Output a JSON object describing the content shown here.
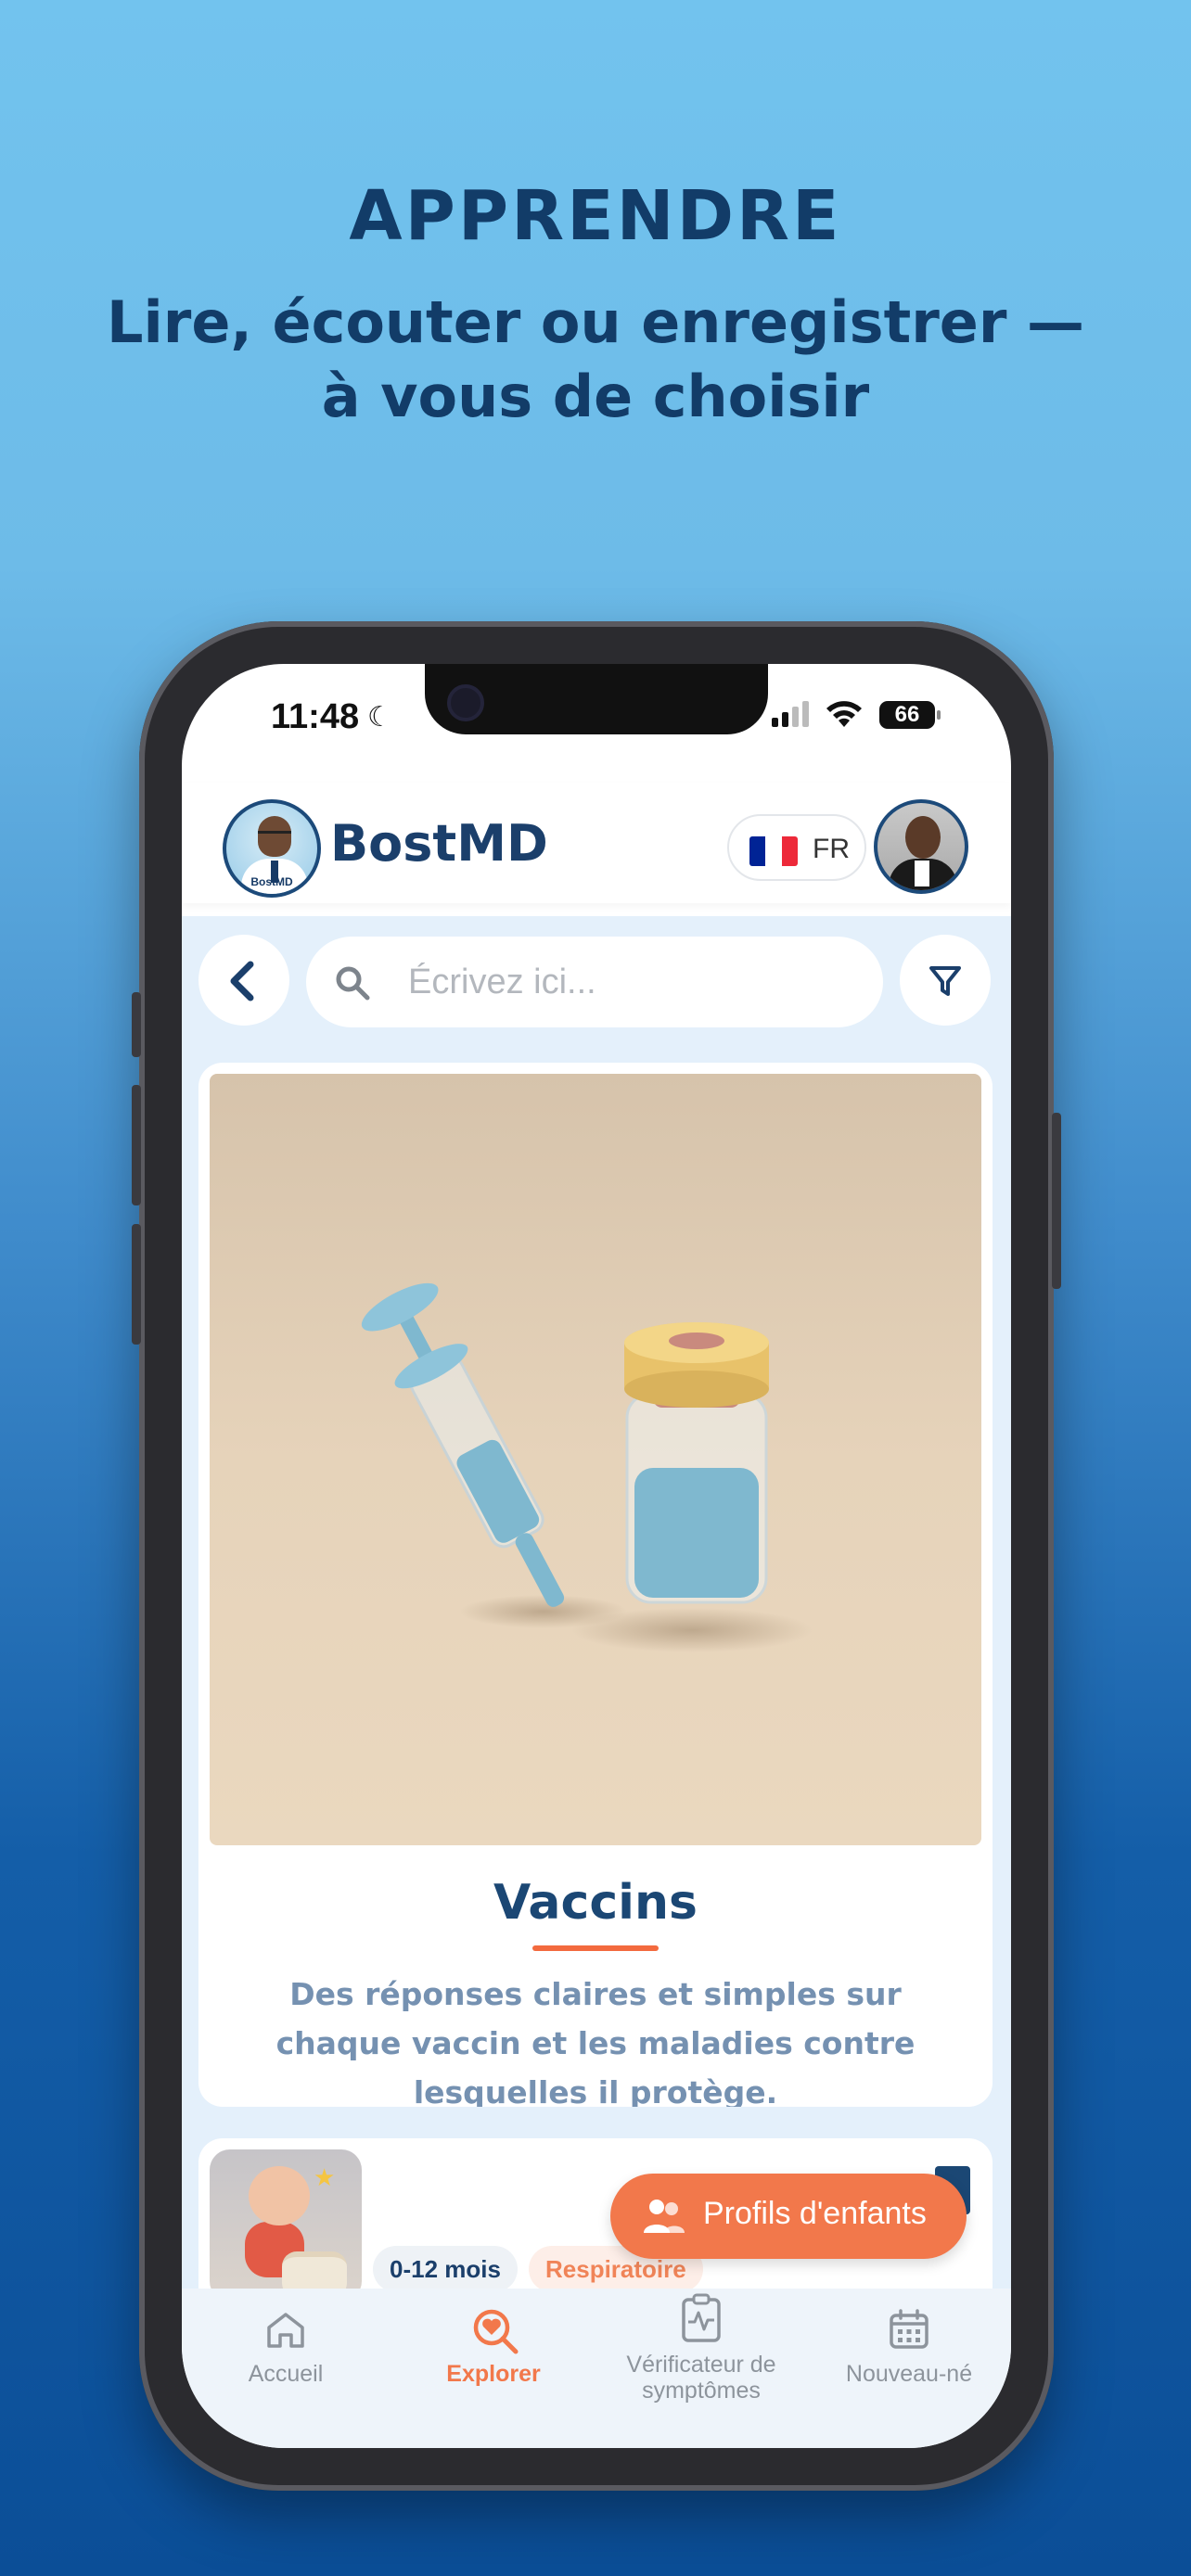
{
  "promo": {
    "headline": "APPRENDRE",
    "subheadline": "Lire, écouter ou enregistrer — à vous de choisir"
  },
  "status_bar": {
    "time": "11:48",
    "battery": "66"
  },
  "header": {
    "brand": "BostMD",
    "logo_tag": "BostMD",
    "language_code": "FR",
    "flag_colors": [
      "#002395",
      "#ffffff",
      "#ed2939"
    ]
  },
  "search": {
    "placeholder": "Écrivez ici..."
  },
  "featured_card": {
    "title": "Vaccins",
    "description": "Des réponses claires et simples sur chaque vaccin et les maladies contre lesquelles il protège.",
    "image_icon": "syringe-vial-illustration"
  },
  "list_card": {
    "age_tag": "0-12 mois",
    "category_tag": "Respiratoire"
  },
  "fab": {
    "label": "Profils d'enfants"
  },
  "bottom_nav": {
    "items": [
      {
        "label": "Accueil",
        "icon": "home-icon",
        "active": false
      },
      {
        "label": "Explorer",
        "icon": "explore-heart-search-icon",
        "active": true
      },
      {
        "label": "Vérificateur de symptômes",
        "icon": "clipboard-pulse-icon",
        "active": false
      },
      {
        "label": "Nouveau-né",
        "icon": "calendar-icon",
        "active": false
      }
    ]
  },
  "colors": {
    "accent": "#f2784b",
    "brand_navy": "#1b3f6b",
    "background_top": "#72c3ee",
    "background_bottom": "#0b4e97"
  }
}
